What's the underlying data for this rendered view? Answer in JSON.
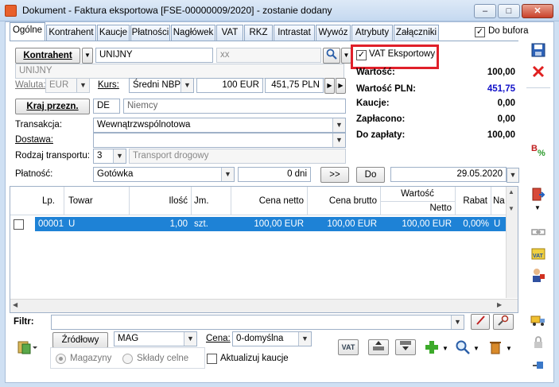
{
  "window": {
    "title": "Dokument - Faktura eksportowa [FSE-00000009/2020]  - zostanie dodany",
    "minimize": "–",
    "maximize": "□",
    "close": "✕"
  },
  "tabs": [
    {
      "label": "Ogólne"
    },
    {
      "label": "Kontrahent"
    },
    {
      "label": "Kaucje"
    },
    {
      "label": "Płatności"
    },
    {
      "label": "Nagłówek"
    },
    {
      "label": "VAT"
    },
    {
      "label": "RKZ"
    },
    {
      "label": "Intrastat"
    },
    {
      "label": "Wywóz"
    },
    {
      "label": "Atrybuty"
    },
    {
      "label": "Załączniki"
    }
  ],
  "do_bufora": {
    "label": "Do bufora",
    "checked": "✓"
  },
  "kontrahent": {
    "button": "Kontrahent",
    "code": "UNIJNY",
    "second": "xx",
    "name": "UNIJNY"
  },
  "vat_eksportowy": {
    "label": "VAT Eksportowy",
    "checked": "✓"
  },
  "waluta": {
    "label": "Waluta:",
    "value": "EUR"
  },
  "kurs": {
    "label": "Kurs:",
    "type": "Średni NBP",
    "amount": "100 EUR",
    "pln": "451,75 PLN"
  },
  "kraj": {
    "button": "Kraj przezn.",
    "code": "DE",
    "name": "Niemcy"
  },
  "transakcja": {
    "label": "Transakcja:",
    "value": "Wewnątrzwspólnotowa"
  },
  "dostawa": {
    "label": "Dostawa:",
    "value": ""
  },
  "rodzaj_transportu": {
    "label": "Rodzaj transportu:",
    "code": "3",
    "name": "Transport drogowy"
  },
  "platnosc": {
    "label": "Płatność:",
    "method": "Gotówka",
    "days": "0 dni",
    "arrow_btn": ">>",
    "do_btn": "Do",
    "date": "29.05.2020"
  },
  "summary": [
    {
      "label": "Wartość:",
      "value": "100,00",
      "color": "#000000"
    },
    {
      "label": "Wartość PLN:",
      "value": "451,75",
      "color": "#1010c8"
    },
    {
      "label": "Kaucje:",
      "value": "0,00",
      "color": "#000000"
    },
    {
      "label": "Zapłacono:",
      "value": "0,00",
      "color": "#000000"
    },
    {
      "label": "Do zapłaty:",
      "value": "100,00",
      "color": "#000000"
    }
  ],
  "grid": {
    "headers": {
      "lp": "Lp.",
      "towar": "Towar",
      "ilosc": "Ilość",
      "jm": "Jm.",
      "cena_netto": "Cena netto",
      "cena_brutto": "Cena brutto",
      "wartosc": "Wartość",
      "netto": "Netto",
      "rabat": "Rabat",
      "na": "Na"
    },
    "rows": [
      {
        "lp": "00001",
        "towar": "U",
        "ilosc": "1,00",
        "jm": "szt.",
        "cena_netto": "100,00 EUR",
        "cena_brutto": "100,00 EUR",
        "netto": "100,00 EUR",
        "rabat": "0,00%",
        "na": "U"
      }
    ]
  },
  "filter": {
    "label": "Filtr:",
    "value": ""
  },
  "bottom": {
    "zrodlowy_btn": "Źródłowy",
    "magazyn": "MAG",
    "cena_label": "Cena:",
    "cena_value": "0-domyślna",
    "magazyny": "Magazyny",
    "sklady": "Składy celne",
    "aktualizuj": "Aktualizuj kaucje",
    "vat_icon": "VAT"
  },
  "icons": {
    "save": "floppy-disk-icon",
    "cancel": "cancel-x-icon",
    "percent": "percent-icon",
    "export": "export-icon",
    "link": "link-icon",
    "vat": "vat-icon",
    "user": "user-icon",
    "truck": "truck-icon",
    "lock": "lock-icon",
    "pin": "pin-icon"
  },
  "colors": {
    "selection": "#1e82d6",
    "highlight_frame": "#e0202a",
    "pln_value": "#1010c8"
  }
}
